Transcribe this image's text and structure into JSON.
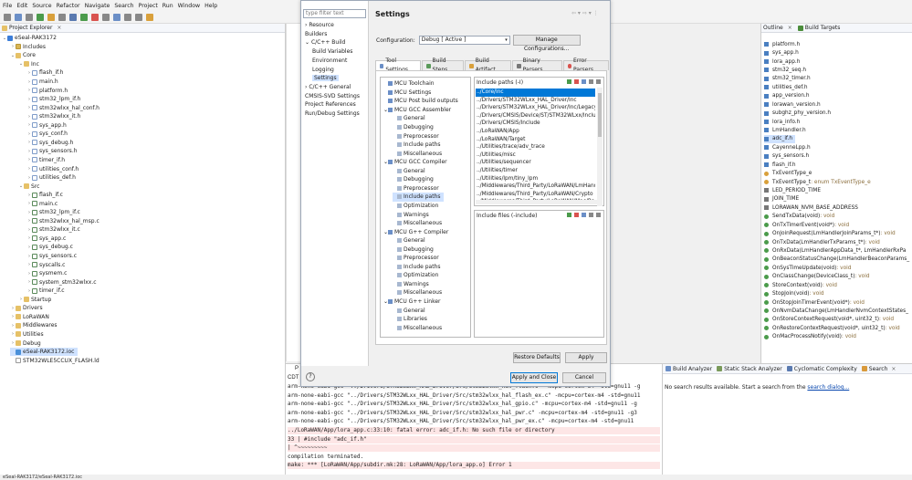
{
  "menu": [
    "File",
    "Edit",
    "Source",
    "Refactor",
    "Navigate",
    "Search",
    "Project",
    "Run",
    "Window",
    "Help"
  ],
  "project_explorer": {
    "tab_label": "Project Explorer",
    "rows": [
      {
        "indent": 0,
        "twisty": "v",
        "icon": "proj",
        "label": "eSeal-RAK3172"
      },
      {
        "indent": 1,
        "twisty": ">",
        "icon": "folds",
        "label": "Includes"
      },
      {
        "indent": 1,
        "twisty": "v",
        "icon": "fold",
        "label": "Core"
      },
      {
        "indent": 2,
        "twisty": "v",
        "icon": "fold",
        "label": "Inc"
      },
      {
        "indent": 3,
        "twisty": ">",
        "icon": "h",
        "label": "flash_if.h"
      },
      {
        "indent": 3,
        "twisty": ">",
        "icon": "h",
        "label": "main.h"
      },
      {
        "indent": 3,
        "twisty": ">",
        "icon": "h",
        "label": "platform.h"
      },
      {
        "indent": 3,
        "twisty": ">",
        "icon": "h",
        "label": "stm32_lpm_if.h"
      },
      {
        "indent": 3,
        "twisty": ">",
        "icon": "h",
        "label": "stm32wlxx_hal_conf.h"
      },
      {
        "indent": 3,
        "twisty": ">",
        "icon": "h",
        "label": "stm32wlxx_it.h"
      },
      {
        "indent": 3,
        "twisty": ">",
        "icon": "h",
        "label": "sys_app.h"
      },
      {
        "indent": 3,
        "twisty": ">",
        "icon": "h",
        "label": "sys_conf.h"
      },
      {
        "indent": 3,
        "twisty": ">",
        "icon": "h",
        "label": "sys_debug.h"
      },
      {
        "indent": 3,
        "twisty": ">",
        "icon": "h",
        "label": "sys_sensors.h"
      },
      {
        "indent": 3,
        "twisty": ">",
        "icon": "h",
        "label": "timer_if.h"
      },
      {
        "indent": 3,
        "twisty": ">",
        "icon": "h",
        "label": "utilities_conf.h"
      },
      {
        "indent": 3,
        "twisty": ">",
        "icon": "h",
        "label": "utilities_def.h"
      },
      {
        "indent": 2,
        "twisty": "v",
        "icon": "fold",
        "label": "Src"
      },
      {
        "indent": 3,
        "twisty": ">",
        "icon": "c",
        "label": "flash_if.c"
      },
      {
        "indent": 3,
        "twisty": ">",
        "icon": "c",
        "label": "main.c"
      },
      {
        "indent": 3,
        "twisty": ">",
        "icon": "c",
        "label": "stm32_lpm_if.c"
      },
      {
        "indent": 3,
        "twisty": ">",
        "icon": "c",
        "label": "stm32wlxx_hal_msp.c"
      },
      {
        "indent": 3,
        "twisty": ">",
        "icon": "c",
        "label": "stm32wlxx_it.c"
      },
      {
        "indent": 3,
        "twisty": ">",
        "icon": "c",
        "label": "sys_app.c"
      },
      {
        "indent": 3,
        "twisty": ">",
        "icon": "c",
        "label": "sys_debug.c"
      },
      {
        "indent": 3,
        "twisty": ">",
        "icon": "c",
        "label": "sys_sensors.c"
      },
      {
        "indent": 3,
        "twisty": ">",
        "icon": "c",
        "label": "syscalls.c"
      },
      {
        "indent": 3,
        "twisty": ">",
        "icon": "c",
        "label": "sysmem.c"
      },
      {
        "indent": 3,
        "twisty": ">",
        "icon": "c",
        "label": "system_stm32wlxx.c"
      },
      {
        "indent": 3,
        "twisty": ">",
        "icon": "c",
        "label": "timer_if.c"
      },
      {
        "indent": 2,
        "twisty": ">",
        "icon": "fold",
        "label": "Startup"
      },
      {
        "indent": 1,
        "twisty": ">",
        "icon": "fold",
        "label": "Drivers"
      },
      {
        "indent": 1,
        "twisty": ">",
        "icon": "fold",
        "label": "LoRaWAN"
      },
      {
        "indent": 1,
        "twisty": ">",
        "icon": "fold",
        "label": "Middlewares"
      },
      {
        "indent": 1,
        "twisty": ">",
        "icon": "fold",
        "label": "Utilities"
      },
      {
        "indent": 1,
        "twisty": ">",
        "icon": "fold",
        "label": "Debug"
      },
      {
        "indent": 1,
        "twisty": "",
        "icon": "ioc",
        "label": "eSeal-RAK3172.ioc",
        "selected": true
      },
      {
        "indent": 1,
        "twisty": "",
        "icon": "ld",
        "label": "STM32WLE5CCUX_FLASH.ld"
      }
    ]
  },
  "dialog": {
    "filter_placeholder": "type filter text",
    "nav": [
      {
        "indent": 0,
        "twisty": ">",
        "label": "Resource"
      },
      {
        "indent": 0,
        "twisty": "",
        "label": "Builders"
      },
      {
        "indent": 0,
        "twisty": "v",
        "label": "C/C++ Build"
      },
      {
        "indent": 1,
        "twisty": "",
        "label": "Build Variables"
      },
      {
        "indent": 1,
        "twisty": "",
        "label": "Environment"
      },
      {
        "indent": 1,
        "twisty": "",
        "label": "Logging"
      },
      {
        "indent": 1,
        "twisty": "",
        "label": "Settings",
        "selected": true
      },
      {
        "indent": 0,
        "twisty": ">",
        "label": "C/C++ General"
      },
      {
        "indent": 0,
        "twisty": "",
        "label": "CMSIS-SVD Settings"
      },
      {
        "indent": 0,
        "twisty": "",
        "label": "Project References"
      },
      {
        "indent": 0,
        "twisty": "",
        "label": "Run/Debug Settings"
      }
    ],
    "title": "Settings",
    "configuration_label": "Configuration:",
    "configuration_value": "Debug  [ Active ]",
    "manage_button": "Manage Configurations...",
    "tabs": [
      "Tool Settings",
      "Build Steps",
      "Build Artifact",
      "Binary Parsers",
      "Error Parsers"
    ],
    "tool_tree": [
      {
        "indent": 0,
        "label": "MCU Toolchain"
      },
      {
        "indent": 0,
        "label": "MCU Settings"
      },
      {
        "indent": 0,
        "label": "MCU Post build outputs"
      },
      {
        "indent": 0,
        "twisty": "v",
        "label": "MCU GCC Assembler"
      },
      {
        "indent": 1,
        "label": "General"
      },
      {
        "indent": 1,
        "label": "Debugging"
      },
      {
        "indent": 1,
        "label": "Preprocessor"
      },
      {
        "indent": 1,
        "label": "Include paths"
      },
      {
        "indent": 1,
        "label": "Miscellaneous"
      },
      {
        "indent": 0,
        "twisty": "v",
        "label": "MCU GCC Compiler"
      },
      {
        "indent": 1,
        "label": "General"
      },
      {
        "indent": 1,
        "label": "Debugging"
      },
      {
        "indent": 1,
        "label": "Preprocessor"
      },
      {
        "indent": 1,
        "label": "Include paths",
        "selected": true
      },
      {
        "indent": 1,
        "label": "Optimization"
      },
      {
        "indent": 1,
        "label": "Warnings"
      },
      {
        "indent": 1,
        "label": "Miscellaneous"
      },
      {
        "indent": 0,
        "twisty": "v",
        "label": "MCU G++ Compiler"
      },
      {
        "indent": 1,
        "label": "General"
      },
      {
        "indent": 1,
        "label": "Debugging"
      },
      {
        "indent": 1,
        "label": "Preprocessor"
      },
      {
        "indent": 1,
        "label": "Include paths"
      },
      {
        "indent": 1,
        "label": "Optimization"
      },
      {
        "indent": 1,
        "label": "Warnings"
      },
      {
        "indent": 1,
        "label": "Miscellaneous"
      },
      {
        "indent": 0,
        "twisty": "v",
        "label": "MCU G++ Linker"
      },
      {
        "indent": 1,
        "label": "General"
      },
      {
        "indent": 1,
        "label": "Libraries"
      },
      {
        "indent": 1,
        "label": "Miscellaneous"
      }
    ],
    "include_paths_label": "Include paths (-I)",
    "include_paths": [
      "../Core/Inc",
      "../Drivers/STM32WLxx_HAL_Driver/Inc",
      "../Drivers/STM32WLxx_HAL_Driver/Inc/Legacy",
      "../Drivers/CMSIS/Device/ST/STM32WLxx/Includ",
      "../Drivers/CMSIS/Include",
      "../LoRaWAN/App",
      "../LoRaWAN/Target",
      "../Utilities/trace/adv_trace",
      "../Utilities/misc",
      "../Utilities/sequencer",
      "../Utilities/timer",
      "../Utilities/lpm/tiny_lpm",
      "../Middlewares/Third_Party/LoRaWAN/LmHand",
      "../Middlewares/Third_Party/LoRaWAN/Crypto",
      "../Middlewares/Third_Party/LoRaWAN/Mac/Reg"
    ],
    "include_files_label": "Include files (-include)",
    "restore_defaults": "Restore Defaults",
    "apply": "Apply",
    "apply_and_close": "Apply and Close",
    "cancel": "Cancel",
    "help_glyph": "?"
  },
  "outline": {
    "tab_outline": "Outline",
    "tab_build_targets": "Build Targets",
    "rows": [
      {
        "kind": "inc",
        "text": "platform.h"
      },
      {
        "kind": "inc",
        "text": "sys_app.h"
      },
      {
        "kind": "inc",
        "text": "lora_app.h"
      },
      {
        "kind": "inc",
        "text": "stm32_seq.h"
      },
      {
        "kind": "inc",
        "text": "stm32_timer.h"
      },
      {
        "kind": "inc",
        "text": "utilities_def.h"
      },
      {
        "kind": "inc",
        "text": "app_version.h"
      },
      {
        "kind": "inc",
        "text": "lorawan_version.h"
      },
      {
        "kind": "inc",
        "text": "subghz_phy_version.h"
      },
      {
        "kind": "inc",
        "text": "lora_info.h"
      },
      {
        "kind": "inc",
        "text": "LmHandler.h"
      },
      {
        "kind": "inc-warn",
        "text": "adc_if.h",
        "selected": true
      },
      {
        "kind": "inc",
        "text": "CayenneLpp.h"
      },
      {
        "kind": "inc",
        "text": "sys_sensors.h"
      },
      {
        "kind": "inc",
        "text": "flash_if.h"
      },
      {
        "kind": "enum",
        "text": "TxEventType_e"
      },
      {
        "kind": "enum",
        "text": "TxEventType_t",
        "type": " : enum TxEventType_e"
      },
      {
        "kind": "def",
        "text": "LED_PERIOD_TIME"
      },
      {
        "kind": "def",
        "text": "JOIN_TIME"
      },
      {
        "kind": "def",
        "text": "LORAWAN_NVM_BASE_ADDRESS"
      },
      {
        "kind": "fn",
        "text": "SendTxData(void)",
        "type": " : void"
      },
      {
        "kind": "fn",
        "text": "OnTxTimerEvent(void*)",
        "type": " : void"
      },
      {
        "kind": "fn",
        "text": "OnJoinRequest(LmHandlerJoinParams_t*)",
        "type": " : void"
      },
      {
        "kind": "fn",
        "text": "OnTxData(LmHandlerTxParams_t*)",
        "type": " : void"
      },
      {
        "kind": "fn",
        "text": "OnRxData(LmHandlerAppData_t*, LmHandlerRxPa",
        "type": ""
      },
      {
        "kind": "fn",
        "text": "OnBeaconStatusChange(LmHandlerBeaconParams_",
        "type": ""
      },
      {
        "kind": "fn",
        "text": "OnSysTimeUpdate(void)",
        "type": " : void"
      },
      {
        "kind": "fn",
        "text": "OnClassChange(DeviceClass_t)",
        "type": " : void"
      },
      {
        "kind": "fn",
        "text": "StoreContext(void)",
        "type": " : void"
      },
      {
        "kind": "fn",
        "text": "StopJoin(void)",
        "type": " : void"
      },
      {
        "kind": "fn",
        "text": "OnStopJoinTimerEvent(void*)",
        "type": " : void"
      },
      {
        "kind": "fn",
        "text": "OnNvmDataChange(LmHandlerNvmContextStates_",
        "type": ""
      },
      {
        "kind": "fn",
        "text": "OnStoreContextRequest(void*, uint32_t)",
        "type": " : void"
      },
      {
        "kind": "fn",
        "text": "OnRestoreContextRequest(void*, uint32_t)",
        "type": " : void"
      },
      {
        "kind": "fn",
        "text": "OnMacProcessNotify(void)",
        "type": " : void"
      }
    ]
  },
  "console": {
    "tab_left": "P",
    "cdt_label": "CDT",
    "lines": [
      {
        "err": false,
        "text": "arm-none-eabi-gcc \"../Drivers/STM32WLxx_HAL_Driver/Src/stm32wlxx_hal_flash.c\" -mcpu=cortex-m4 -std=gnu11 -g"
      },
      {
        "err": false,
        "text": "arm-none-eabi-gcc \"../Drivers/STM32WLxx_HAL_Driver/Src/stm32wlxx_hal_flash_ex.c\" -mcpu=cortex-m4 -std=gnu11"
      },
      {
        "err": false,
        "text": "arm-none-eabi-gcc \"../Drivers/STM32WLxx_HAL_Driver/Src/stm32wlxx_hal_gpio.c\" -mcpu=cortex-m4 -std=gnu11 -g"
      },
      {
        "err": false,
        "text": "arm-none-eabi-gcc \"../Drivers/STM32WLxx_HAL_Driver/Src/stm32wlxx_hal_pwr.c\" -mcpu=cortex-m4 -std=gnu11 -g3"
      },
      {
        "err": false,
        "text": "arm-none-eabi-gcc \"../Drivers/STM32WLxx_HAL_Driver/Src/stm32wlxx_hal_pwr_ex.c\" -mcpu=cortex-m4 -std=gnu11"
      },
      {
        "err": true,
        "text": "../LoRaWAN/App/lora_app.c:33:10: fatal error: adc_if.h: No such file or directory"
      },
      {
        "err": true,
        "text": "   33 | #include \"adc_if.h\""
      },
      {
        "err": true,
        "text": "      |          ^~~~~~~~~~"
      },
      {
        "err": false,
        "text": "compilation terminated."
      },
      {
        "err": true,
        "text": "make: *** [LoRaWAN/App/subdir.mk:28: LoRaWAN/App/lora_app.o] Error 1"
      }
    ]
  },
  "search_panel": {
    "tabs": [
      "Build Analyzer",
      "Static Stack Analyzer",
      "Cyclomatic Complexity",
      "Search"
    ],
    "message": "No search results available. Start a search from the ",
    "link": "search dialog..."
  },
  "status_bar": "eSeal-RAK3172/eSeal-RAK3172.ioc",
  "colors": {
    "selection": "#0078d7",
    "tree_selection": "#cfe2ff",
    "error_bg": "#fde6e6",
    "link": "#0645ad"
  }
}
